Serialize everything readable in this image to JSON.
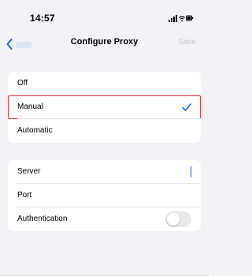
{
  "status_bar": {
    "time": "14:57",
    "icons": [
      "signal-icon",
      "wifi-icon",
      "battery-icon"
    ]
  },
  "nav": {
    "title": "Configure Proxy",
    "save_label": "Save",
    "back_icon": "chevron-left-icon"
  },
  "proxy_modes": {
    "options": [
      {
        "label": "Off",
        "selected": false
      },
      {
        "label": "Manual",
        "selected": true
      },
      {
        "label": "Automatic",
        "selected": false
      }
    ]
  },
  "manual_settings": {
    "server_label": "Server",
    "server_value": "",
    "port_label": "Port",
    "port_value": "",
    "authentication_label": "Authentication",
    "authentication_enabled": false
  },
  "colors": {
    "accent": "#0a64ff",
    "highlight": "#e23b3b",
    "background": "#f2f2f7"
  }
}
